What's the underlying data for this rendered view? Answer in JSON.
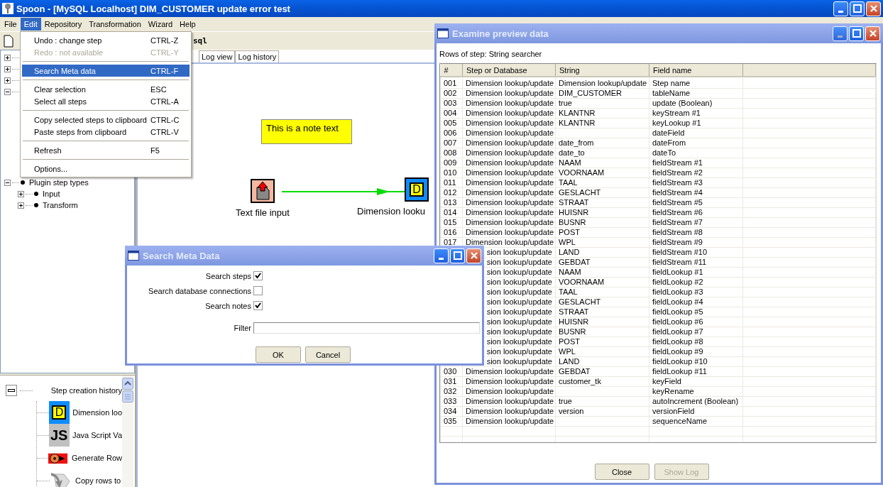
{
  "window": {
    "title": "Spoon - [MySQL Localhost]  DIM_CUSTOMER update error test"
  },
  "menu_bar": [
    {
      "label": "File",
      "selected": false
    },
    {
      "label": "Edit",
      "selected": true
    },
    {
      "label": "Repository",
      "selected": false
    },
    {
      "label": "Transformation",
      "selected": false
    },
    {
      "label": "Wizard",
      "selected": false
    },
    {
      "label": "Help",
      "selected": false
    }
  ],
  "edit_menu": {
    "groups": [
      [
        {
          "label": "Undo : change step",
          "shortcut": "CTRL-Z",
          "disabled": false,
          "selected": false
        },
        {
          "label": "Redo : not available",
          "shortcut": "CTRL-Y",
          "disabled": true,
          "selected": false
        }
      ],
      [
        {
          "label": "Search Meta data",
          "shortcut": "CTRL-F",
          "disabled": false,
          "selected": true
        }
      ],
      [
        {
          "label": "Clear selection",
          "shortcut": "ESC",
          "disabled": false,
          "selected": false
        },
        {
          "label": "Select all steps",
          "shortcut": "CTRL-A",
          "disabled": false,
          "selected": false
        }
      ],
      [
        {
          "label": "Copy selected steps to clipboard",
          "shortcut": "CTRL-C",
          "disabled": false,
          "selected": false
        },
        {
          "label": "Paste steps from clipboard",
          "shortcut": "CTRL-V",
          "disabled": false,
          "selected": false
        }
      ],
      [
        {
          "label": "Refresh",
          "shortcut": "F5",
          "disabled": false,
          "selected": false
        }
      ],
      [
        {
          "label": "Options...",
          "disabled": false,
          "selected": false
        }
      ]
    ]
  },
  "toolbar": {
    "label": "sql"
  },
  "tree": [
    {
      "expanded": false
    },
    {
      "expanded": false
    },
    {
      "expanded": false
    },
    {
      "expanded": true
    },
    {
      "label": "Plugin step types",
      "expanded": true,
      "children": [
        {
          "label": "Input",
          "expanded": false
        },
        {
          "label": "Transform",
          "expanded": false
        }
      ]
    }
  ],
  "history": {
    "title": "Step creation history",
    "expanded": true,
    "items": [
      {
        "label": "Dimension loo",
        "kind": "dimension",
        "badge": "D"
      },
      {
        "label": "Java Script Va",
        "kind": "javascript",
        "badge": "JS"
      },
      {
        "label": "Generate Row",
        "kind": "generate"
      },
      {
        "label": "Copy rows to",
        "kind": "copy"
      }
    ]
  },
  "canvas_tabs": [
    {
      "label": "Log view",
      "selected": false
    },
    {
      "label": "Log history",
      "selected": false
    }
  ],
  "canvas": {
    "note": "This is a note text",
    "steps": [
      {
        "label": "Text file input",
        "kind": "text-input"
      },
      {
        "label": "Dimension looku",
        "kind": "dimension",
        "badge": "D"
      }
    ]
  },
  "examine": {
    "title": "Examine preview data",
    "caption": "Rows of step: String searcher",
    "columns": [
      "#",
      "Step or Database",
      "String",
      "Field name"
    ],
    "rows": [
      {
        "num": "001",
        "step": "Dimension lookup/update",
        "string": "Dimension lookup/update",
        "field": "Step name"
      },
      {
        "num": "002",
        "step": "Dimension lookup/update",
        "string": "DIM_CUSTOMER",
        "field": "tableName"
      },
      {
        "num": "003",
        "step": "Dimension lookup/update",
        "string": "true",
        "field": "update (Boolean)"
      },
      {
        "num": "004",
        "step": "Dimension lookup/update",
        "string": "KLANTNR",
        "field": "keyStream #1"
      },
      {
        "num": "005",
        "step": "Dimension lookup/update",
        "string": "KLANTNR",
        "field": "keyLookup #1"
      },
      {
        "num": "006",
        "step": "Dimension lookup/update",
        "field": "dateField"
      },
      {
        "num": "007",
        "step": "Dimension lookup/update",
        "string": "date_from",
        "field": "dateFrom"
      },
      {
        "num": "008",
        "step": "Dimension lookup/update",
        "string": "date_to",
        "field": "dateTo"
      },
      {
        "num": "009",
        "step": "Dimension lookup/update",
        "string": "NAAM",
        "field": "fieldStream #1"
      },
      {
        "num": "010",
        "step": "Dimension lookup/update",
        "string": "VOORNAAM",
        "field": "fieldStream #2"
      },
      {
        "num": "011",
        "step": "Dimension lookup/update",
        "string": "TAAL",
        "field": "fieldStream #3"
      },
      {
        "num": "012",
        "step": "Dimension lookup/update",
        "string": "GESLACHT",
        "field": "fieldStream #4"
      },
      {
        "num": "013",
        "step": "Dimension lookup/update",
        "string": "STRAAT",
        "field": "fieldStream #5"
      },
      {
        "num": "014",
        "step": "Dimension lookup/update",
        "string": "HUISNR",
        "field": "fieldStream #6"
      },
      {
        "num": "015",
        "step": "Dimension lookup/update",
        "string": "BUSNR",
        "field": "fieldStream #7"
      },
      {
        "num": "016",
        "step": "Dimension lookup/update",
        "string": "POST",
        "field": "fieldStream #8"
      },
      {
        "num": "017",
        "step": "Dimension lookup/update",
        "string": "WPL",
        "field": "fieldStream #9"
      },
      {
        "step": "sion lookup/update",
        "string": "LAND",
        "field": "fieldStream #10"
      },
      {
        "step": "sion lookup/update",
        "string": "GEBDAT",
        "field": "fieldStream #11"
      },
      {
        "step": "sion lookup/update",
        "string": "NAAM",
        "field": "fieldLookup #1"
      },
      {
        "step": "sion lookup/update",
        "string": "VOORNAAM",
        "field": "fieldLookup #2"
      },
      {
        "step": "sion lookup/update",
        "string": "TAAL",
        "field": "fieldLookup #3"
      },
      {
        "step": "sion lookup/update",
        "string": "GESLACHT",
        "field": "fieldLookup #4"
      },
      {
        "step": "sion lookup/update",
        "string": "STRAAT",
        "field": "fieldLookup #5"
      },
      {
        "step": "sion lookup/update",
        "string": "HUISNR",
        "field": "fieldLookup #6"
      },
      {
        "step": "sion lookup/update",
        "string": "BUSNR",
        "field": "fieldLookup #7"
      },
      {
        "step": "sion lookup/update",
        "string": "POST",
        "field": "fieldLookup #8"
      },
      {
        "step": "sion lookup/update",
        "string": "WPL",
        "field": "fieldLookup #9"
      },
      {
        "step": "sion lookup/update",
        "string": "LAND",
        "field": "fieldLookup #10"
      },
      {
        "num": "030",
        "step": "Dimension lookup/update",
        "string": "GEBDAT",
        "field": "fieldLookup #11"
      },
      {
        "num": "031",
        "step": "Dimension lookup/update",
        "string": "customer_tk",
        "field": "keyField"
      },
      {
        "num": "032",
        "step": "Dimension lookup/update",
        "field": "keyRename"
      },
      {
        "num": "033",
        "step": "Dimension lookup/update",
        "string": "true",
        "field": "autoIncrement (Boolean)"
      },
      {
        "num": "034",
        "step": "Dimension lookup/update",
        "string": "version",
        "field": "versionField"
      },
      {
        "num": "035",
        "step": "Dimension lookup/update",
        "field": "sequenceName"
      }
    ],
    "buttons": [
      {
        "label": "Close",
        "disabled": false
      },
      {
        "label": "Show Log",
        "disabled": true
      }
    ]
  },
  "search_dialog": {
    "title": "Search Meta Data",
    "options": [
      {
        "label": "Search steps",
        "checked": true
      },
      {
        "label": "Search database connections",
        "checked": false
      },
      {
        "label": "Search notes",
        "checked": true
      }
    ],
    "filter": {
      "label": "Filter"
    },
    "buttons": [
      "OK",
      "Cancel"
    ]
  }
}
